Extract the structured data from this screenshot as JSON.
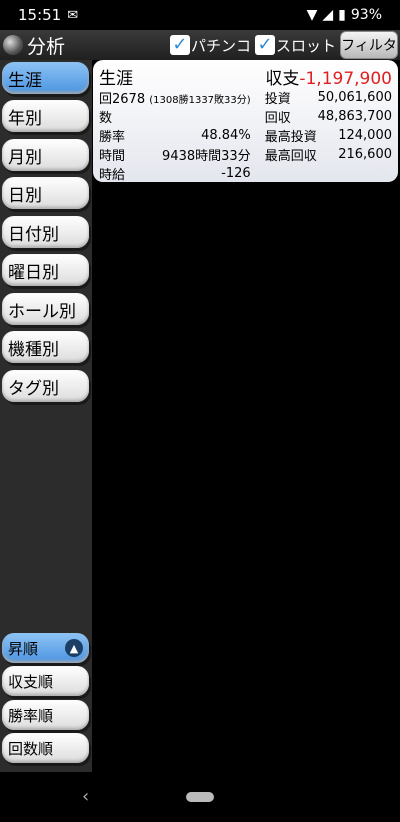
{
  "status": {
    "time": "15:51",
    "battery": "93%"
  },
  "app": {
    "title": "分析",
    "pachinko_label": "パチンコ",
    "slot_label": "スロット",
    "filter_label": "フィルタ"
  },
  "sidebar": {
    "items": [
      {
        "label": "生涯"
      },
      {
        "label": "年別"
      },
      {
        "label": "月別"
      },
      {
        "label": "日別"
      },
      {
        "label": "日付別"
      },
      {
        "label": "曜日別"
      },
      {
        "label": "ホール別"
      },
      {
        "label": "機種別"
      },
      {
        "label": "タグ別"
      }
    ],
    "sort": [
      {
        "label": "昇順"
      },
      {
        "label": "収支順"
      },
      {
        "label": "勝率順"
      },
      {
        "label": "回数順"
      }
    ]
  },
  "card": {
    "title": "生涯",
    "profit_label": "収支",
    "profit_value": "-1,197,900",
    "count_value": "2678",
    "count_detail": "(1308勝1337敗33分)",
    "count_label_a": "回",
    "count_label_b": "数",
    "winrate_label": "勝率",
    "winrate_value": "48.84%",
    "time_label": "時間",
    "time_value": "9438時間33分",
    "hourly_label": "時給",
    "hourly_value": "-126",
    "invest_label": "投資",
    "invest_value": "50,061,600",
    "recover_label": "回収",
    "recover_value": "48,863,700",
    "max_invest_label": "最高投資",
    "max_invest_value": "124,000",
    "max_recover_label": "最高回収",
    "max_recover_value": "216,600"
  }
}
